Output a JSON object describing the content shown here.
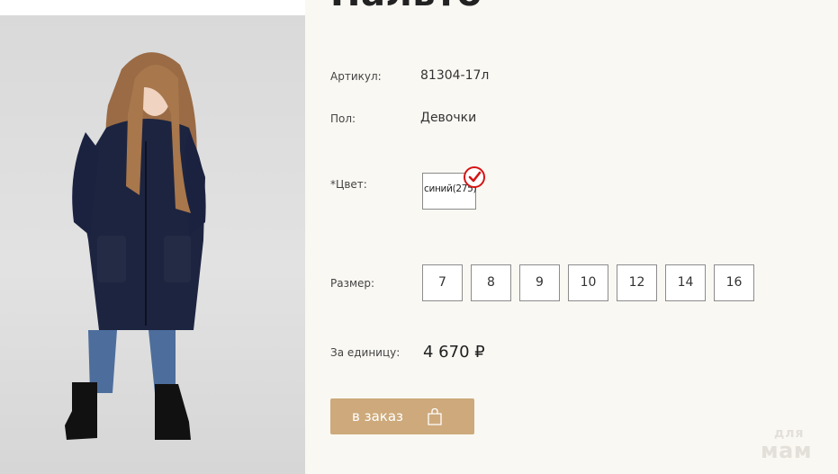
{
  "product": {
    "title": "Пальто",
    "article_label": "Артикул:",
    "article_value": "81304-17л",
    "gender_label": "Пол:",
    "gender_value": "Девочки",
    "color_label": "*Цвет:",
    "color_option": "синий(275)",
    "size_label": "Размер:",
    "sizes": [
      "7",
      "8",
      "9",
      "10",
      "12",
      "14",
      "16"
    ],
    "price_label": "За единицу:",
    "price_value": "4 670 ₽",
    "order_button": "в заказ"
  },
  "watermark": {
    "line1": "для",
    "line2": "мам"
  },
  "colors": {
    "accent": "#cda97b",
    "check": "#d41414",
    "background": "#faf8f3"
  },
  "icons": {
    "bag": "shopping-bag-icon",
    "check": "checkmark-icon"
  }
}
